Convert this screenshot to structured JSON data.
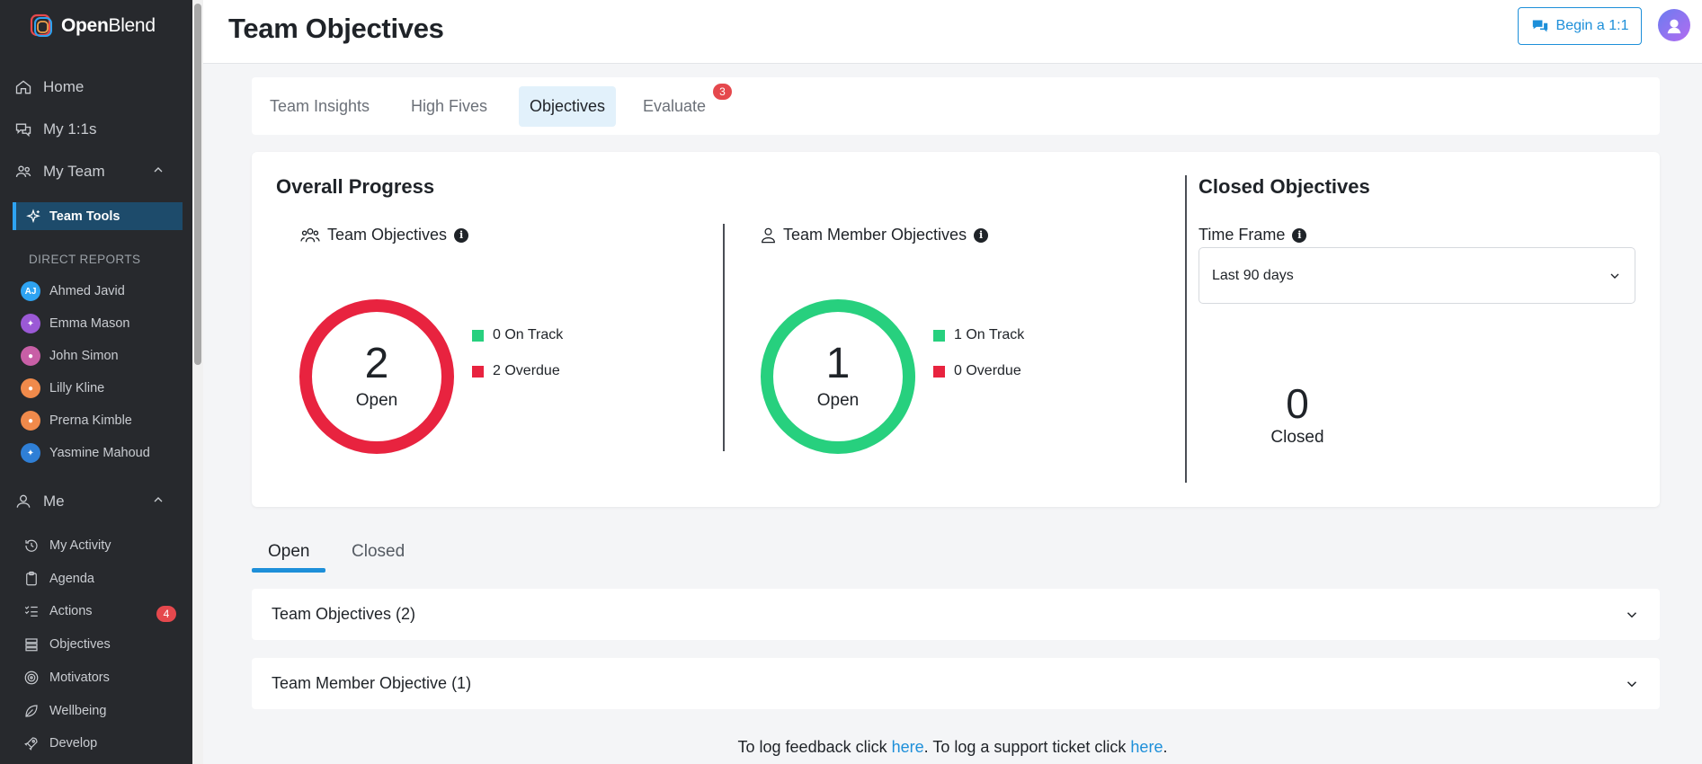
{
  "app": {
    "name_bold": "Open",
    "name_light": "Blend"
  },
  "sidebar": {
    "home": "Home",
    "my_1on1s": "My 1:1s",
    "my_team": "My Team",
    "team_tools": "Team Tools",
    "direct_reports_label": "DIRECT REPORTS",
    "reports": [
      {
        "name": "Ahmed Javid",
        "initials": "AJ",
        "color": "#2ea3f2"
      },
      {
        "name": "Emma Mason",
        "initials": "",
        "color": "#9b59d6"
      },
      {
        "name": "John Simon",
        "initials": "",
        "color": "#c85fa6"
      },
      {
        "name": "Lilly Kline",
        "initials": "",
        "color": "#f08a4b"
      },
      {
        "name": "Prerna Kimble",
        "initials": "",
        "color": "#f08a4b"
      },
      {
        "name": "Yasmine Mahoud",
        "initials": "",
        "color": "#2f7fd6"
      }
    ],
    "me": "Me",
    "me_items": [
      {
        "label": "My Activity",
        "icon": "history-icon"
      },
      {
        "label": "Agenda",
        "icon": "clipboard-icon"
      },
      {
        "label": "Actions",
        "icon": "checklist-icon",
        "badge": "4"
      },
      {
        "label": "Objectives",
        "icon": "objectives-icon"
      },
      {
        "label": "Motivators",
        "icon": "target-icon"
      },
      {
        "label": "Wellbeing",
        "icon": "leaf-icon"
      },
      {
        "label": "Develop",
        "icon": "rocket-icon"
      }
    ]
  },
  "header": {
    "title": "Team Objectives",
    "begin_label": "Begin a 1:1"
  },
  "tabs": [
    {
      "label": "Team Insights"
    },
    {
      "label": "High Fives"
    },
    {
      "label": "Objectives",
      "active": true
    },
    {
      "label": "Evaluate",
      "badge": "3"
    }
  ],
  "overview": {
    "title": "Overall Progress",
    "team": {
      "heading": "Team Objectives",
      "count": "2",
      "count_label": "Open",
      "on_track": "0 On Track",
      "overdue": "2 Overdue",
      "ring_color": "#e8233f"
    },
    "member": {
      "heading": "Team Member Objectives",
      "count": "1",
      "count_label": "Open",
      "on_track": "1 On Track",
      "overdue": "0 Overdue",
      "ring_color": "#27d07e"
    },
    "closed": {
      "title": "Closed Objectives",
      "timeframe_label": "Time Frame",
      "timeframe_value": "Last 90 days",
      "count": "0",
      "count_label": "Closed"
    }
  },
  "colors": {
    "on_track": "#27d07e",
    "overdue": "#e8233f",
    "accent": "#1d8fd9"
  },
  "lower_tabs": {
    "open": "Open",
    "closed": "Closed"
  },
  "accordions": {
    "team": "Team Objectives (2)",
    "member": "Team Member Objective (1)"
  },
  "footer": {
    "p1": "To log feedback click ",
    "link1": "here",
    "p2": ". To log a support ticket click ",
    "link2": "here",
    "p3": "."
  }
}
